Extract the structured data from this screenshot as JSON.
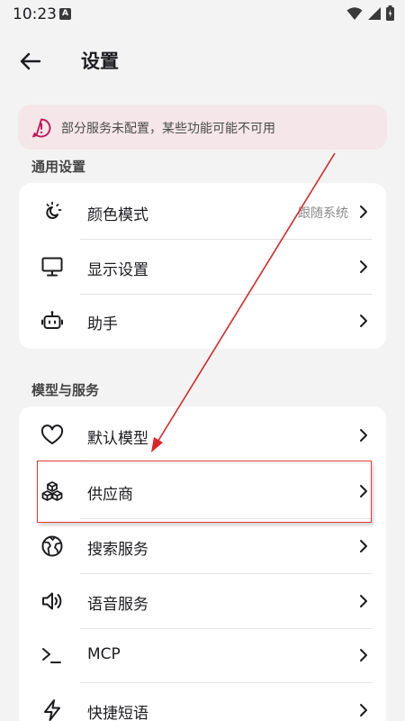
{
  "status_bar": {
    "time": "10:23",
    "badge": "A"
  },
  "header": {
    "title": "设置"
  },
  "banner": {
    "text": "部分服务未配置，某些功能可能不可用",
    "color": "#c2185b"
  },
  "general": {
    "label": "通用设置",
    "items": [
      {
        "label": "颜色模式",
        "value": "跟随系统",
        "icon": "color-mode-icon"
      },
      {
        "label": "显示设置",
        "icon": "monitor-icon"
      },
      {
        "label": "助手",
        "icon": "robot-icon"
      }
    ]
  },
  "models": {
    "label": "模型与服务",
    "items": [
      {
        "label": "默认模型",
        "icon": "heart-icon"
      },
      {
        "label": "供应商",
        "icon": "cubes-icon"
      },
      {
        "label": "搜索服务",
        "icon": "globe-icon"
      },
      {
        "label": "语音服务",
        "icon": "speaker-icon"
      },
      {
        "label": "MCP",
        "icon": "terminal-icon"
      },
      {
        "label": "快捷短语",
        "icon": "bolt-icon"
      }
    ]
  },
  "annotation": {
    "color": "#d92626"
  }
}
